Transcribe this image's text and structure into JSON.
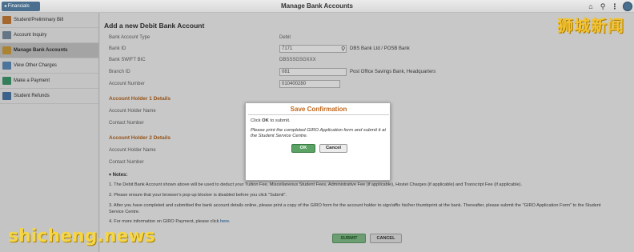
{
  "header": {
    "back_label": "◂ Financials",
    "title": "Manage Bank Accounts",
    "icons": [
      "home-icon",
      "search-icon",
      "more-icon",
      "profile-icon"
    ]
  },
  "sidebar": {
    "items": [
      {
        "label": "Student/Preliminary Bill",
        "icon": "bill-icon",
        "color": "#c87f3a"
      },
      {
        "label": "Account Inquiry",
        "icon": "user-icon",
        "color": "#7a8fa3"
      },
      {
        "label": "Manage Bank Accounts",
        "icon": "bank-icon",
        "color": "#d1a23f",
        "active": true
      },
      {
        "label": "View Other Charges",
        "icon": "charges-icon",
        "color": "#5f8fbf"
      },
      {
        "label": "Make a Payment",
        "icon": "payment-icon",
        "color": "#3f9c6e"
      },
      {
        "label": "Student Refunds",
        "icon": "refund-icon",
        "color": "#4a78a8"
      }
    ]
  },
  "form": {
    "title": "Add a new Debit Bank Account",
    "bank_account_type_label": "Bank Account Type",
    "bank_account_type_value": "Debit",
    "bank_id_label": "Bank ID",
    "bank_id_value": "7171",
    "bank_id_desc": "DBS Bank Ltd / POSB Bank",
    "swift_label": "Bank SWIFT BIC",
    "swift_value": "DBSSSGSGXXX",
    "branch_id_label": "Branch ID",
    "branch_id_value": "081",
    "branch_desc": "Post Office Savings Bank, Headquarters",
    "account_number_label": "Account Number",
    "account_number_value": "010400280",
    "holder1_section": "Account Holder 1 Details",
    "holder1_name_label": "Account Holder Name",
    "holder1_contact_label": "Contact Number",
    "holder2_section": "Account Holder 2 Details",
    "holder2_name_label": "Account Holder Name",
    "holder2_contact_label": "Contact Number"
  },
  "notes": {
    "title": "▾ Notes:",
    "n1": "1.  The Debit Bank Account shown above will be used to deduct your Tuition Fee, Miscellaneous Student Fees, Administrative Fee (if applicable), Hostel Charges (if applicable) and Transcript Fee (if applicable).",
    "n2": "2.  Please ensure that your browser's pop-up blocker is disabled before you click \"Submit\".",
    "n3": "3.  After you have completed and submitted the bank account details online, please print a copy of the GIRO form for the account holder to sign/affix his/her thumbprint at the bank. Thereafter, please submit the \"GIRO Application Form\" to the Student Service Centre.",
    "n4_prefix": "4.  For more information on GIRO Payment, please click ",
    "n4_link": "here"
  },
  "buttons": {
    "submit": "SUBMIT",
    "cancel": "CANCEL"
  },
  "modal": {
    "title": "Save Confirmation",
    "line1_prefix": "Click ",
    "line1_bold": "OK",
    "line1_suffix": " to submit.",
    "line2": "Please print the completed GIRO Application form and submit it at the Student Service Centre.",
    "ok": "OK",
    "cancel": "Cancel"
  },
  "watermark": {
    "cn": "狮城新闻",
    "en": "shicheng.news"
  }
}
